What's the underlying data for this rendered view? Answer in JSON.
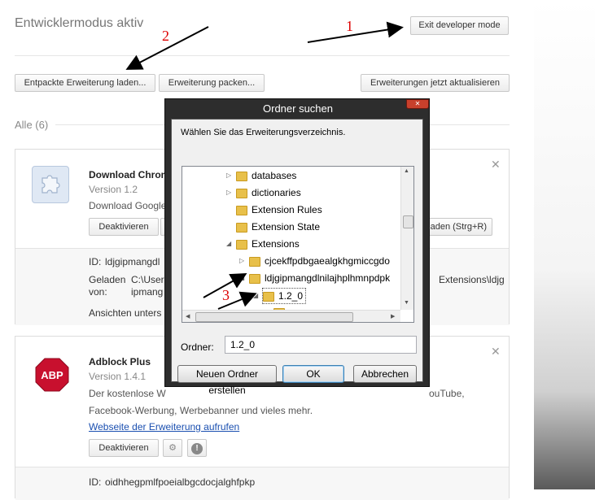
{
  "header": {
    "title": "Entwicklermodus aktiv",
    "exit_button": "Exit developer mode"
  },
  "toolbar": {
    "load_unpacked": "Entpackte Erweiterung laden...",
    "pack": "Erweiterung packen...",
    "update": "Erweiterungen jetzt aktualisieren"
  },
  "section": {
    "all_label": "Alle (6)"
  },
  "ext1": {
    "name": "Download Chrom",
    "version": "Version 1.2",
    "desc": "Download Google",
    "disable": "Deaktivieren",
    "reload": "laden (Strg+R)",
    "id_label": "ID:",
    "id_value": "ldjgipmangdl",
    "loaded_label": "Geladen von:",
    "loaded_line1": "C:\\User",
    "loaded_line2": "ipmang",
    "loaded_right": "Extensions\\ldjg",
    "views": "Ansichten unters"
  },
  "ext2": {
    "name": "Adblock Plus",
    "version": "Version 1.4.1",
    "desc_line1": "Der kostenlose W",
    "desc_line1_right": "ouTube,",
    "desc_line2": "Facebook-Werbung, Werbebanner und vieles mehr.",
    "link": "Webseite der Erweiterung aufrufen",
    "disable": "Deaktivieren",
    "id_label": "ID:",
    "id_value": "oidhhegpmlfpoeialbgcdocjalghfpkp",
    "logo_text": "ABP"
  },
  "dialog": {
    "title": "Ordner suchen",
    "instruction": "Wählen Sie das Erweiterungsverzeichnis.",
    "tree": [
      {
        "label": "databases",
        "expander": "▷"
      },
      {
        "label": "dictionaries",
        "expander": "▷"
      },
      {
        "label": "Extension Rules",
        "expander": ""
      },
      {
        "label": "Extension State",
        "expander": ""
      },
      {
        "label": "Extensions",
        "expander": "◢"
      },
      {
        "label": "cjcekffpdbgaealgkhgmiccgdo",
        "expander": "▷"
      },
      {
        "label": "ldjgipmangdlnilajhplhmnpdpk",
        "expander": "◢"
      },
      {
        "label": "1.2_0",
        "expander": "◢"
      }
    ],
    "folder_label": "Ordner:",
    "folder_value": "1.2_0",
    "new_folder": "Neuen Ordner erstellen",
    "ok": "OK",
    "cancel": "Abbrechen"
  },
  "annotations": {
    "n1": "1",
    "n2": "2",
    "n3": "3"
  },
  "colors": {
    "annotation": "#d00000",
    "link": "#1a4fb0",
    "abp_red": "#c8102e"
  }
}
